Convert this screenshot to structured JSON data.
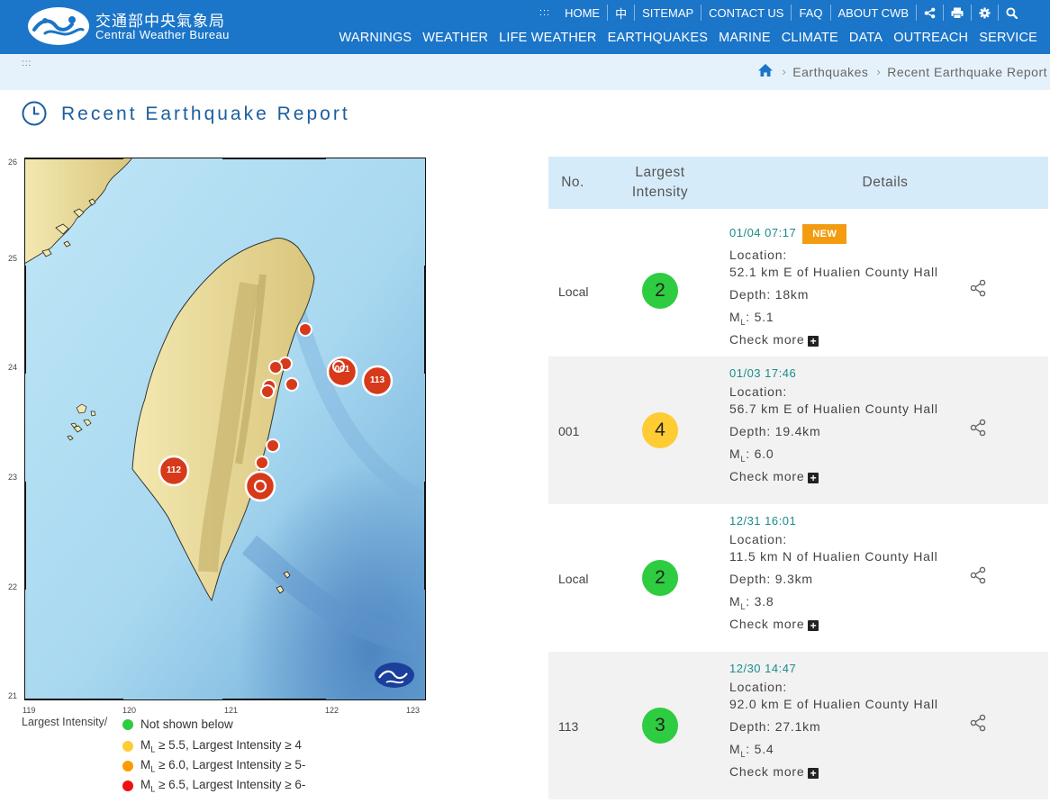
{
  "header": {
    "logo_zh": "交通部中央氣象局",
    "logo_en": "Central Weather Bureau",
    "top_nav": [
      ":::",
      "HOME",
      "中",
      "SITEMAP",
      "CONTACT US",
      "FAQ",
      "ABOUT CWB"
    ],
    "top_icons": [
      "share-icon",
      "print-icon",
      "gear-icon",
      "search-icon"
    ],
    "main_nav": [
      "WARNINGS",
      "WEATHER",
      "LIFE WEATHER",
      "EARTHQUAKES",
      "MARINE",
      "CLIMATE",
      "DATA",
      "OUTREACH",
      "SERVICE"
    ],
    "colors": {
      "bar": "#1b75c8",
      "crumb_bg": "#e6f2fb"
    }
  },
  "breadcrumb": {
    "access_key": ":::",
    "home_icon": "home-icon",
    "items": [
      "Earthquakes",
      "Recent Earthquake Report"
    ]
  },
  "page": {
    "title": "Recent Earthquake Report",
    "title_icon": "clock-icon"
  },
  "map": {
    "lat_labels": [
      "26",
      "25",
      "24",
      "23",
      "22",
      "21"
    ],
    "lon_labels": [
      "119",
      "120",
      "121",
      "122",
      "123"
    ],
    "markers": [
      "001",
      "113",
      "112"
    ],
    "logo_icon": "cwb-logo-icon"
  },
  "legend": {
    "title": "Largest Intensity/",
    "items": [
      {
        "pre": "Not shown below",
        "ml": "",
        "post": "",
        "color": "#2ecc40"
      },
      {
        "pre": "M",
        "ml": "L",
        "post": " ≥ 5.5, Largest Intensity ≥ 4",
        "color": "#ffcc33"
      },
      {
        "pre": "M",
        "ml": "L",
        "post": " ≥ 6.0, Largest Intensity ≥ 5-",
        "color": "#ff9900"
      },
      {
        "pre": "M",
        "ml": "L",
        "post": " ≥ 6.5, Largest Intensity ≥ 6-",
        "color": "#ee1111"
      }
    ]
  },
  "table": {
    "headers": {
      "no": "No.",
      "intensity_1": "Largest",
      "intensity_2": "Intensity",
      "details": "Details"
    },
    "rows": [
      {
        "no": "Local",
        "intensity": "2",
        "color": "#2ecc40",
        "time": "01/04 07:17",
        "badge": "NEW",
        "location_label": "Location:",
        "location": "52.1 km E of Hualien County Hall",
        "depth": "Depth: 18km",
        "ml_pre": "M",
        "ml_sub": "L",
        "ml_val": ": 5.1",
        "more": "Check more"
      },
      {
        "no": "001",
        "intensity": "4",
        "color": "#ffcc33",
        "time": "01/03 17:46",
        "badge": "",
        "location_label": "Location:",
        "location": "56.7 km E of Hualien County Hall",
        "depth": "Depth: 19.4km",
        "ml_pre": "M",
        "ml_sub": "L",
        "ml_val": ": 6.0",
        "more": "Check more"
      },
      {
        "no": "Local",
        "intensity": "2",
        "color": "#2ecc40",
        "time": "12/31 16:01",
        "badge": "",
        "location_label": "Location:",
        "location": "11.5 km N of Hualien County Hall",
        "depth": "Depth: 9.3km",
        "ml_pre": "M",
        "ml_sub": "L",
        "ml_val": ": 3.8",
        "more": "Check more"
      },
      {
        "no": "113",
        "intensity": "3",
        "color": "#2ecc40",
        "time": "12/30 14:47",
        "badge": "",
        "location_label": "Location:",
        "location": "92.0 km E of Hualien County Hall",
        "depth": "Depth: 27.1km",
        "ml_pre": "M",
        "ml_sub": "L",
        "ml_val": ": 5.4",
        "more": "Check more"
      }
    ]
  }
}
